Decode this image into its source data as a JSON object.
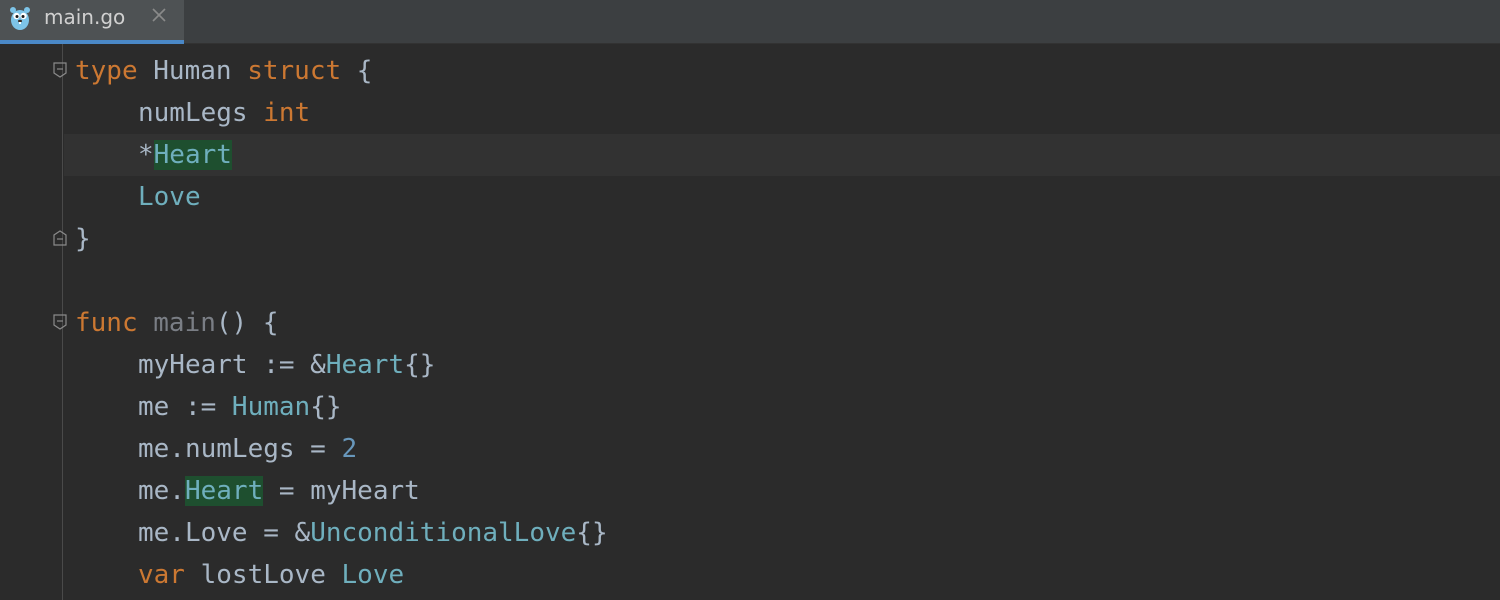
{
  "tab": {
    "filename": "main.go",
    "icon": "gopher-icon",
    "close_icon": "close-icon"
  },
  "code": {
    "l1": {
      "kw1": "type",
      "name": " Human ",
      "kw2": "struct",
      "rest": " {"
    },
    "l2": {
      "field": "numLegs ",
      "type": "int"
    },
    "l3": {
      "star": "*",
      "type": "Heart"
    },
    "l4": {
      "type": "Love"
    },
    "l5": {
      "brace": "}"
    },
    "l7": {
      "kw": "func",
      "fname": " main",
      "rest": "() {"
    },
    "l8": {
      "lhs": "myHeart := &",
      "type": "Heart",
      "rest": "{}"
    },
    "l9": {
      "lhs": "me := ",
      "type": "Human",
      "rest": "{}"
    },
    "l10": {
      "lhs": "me.numLegs = ",
      "num": "2"
    },
    "l11": {
      "lhs": "me.",
      "field": "Heart",
      "rest": " = myHeart"
    },
    "l12": {
      "lhs": "me.Love = &",
      "type": "UnconditionalLove",
      "rest": "{}"
    },
    "l13": {
      "kw": "var",
      "name": " lostLove ",
      "type": "Love"
    }
  },
  "colors": {
    "keyword": "#cc7832",
    "type": "#6fafbd",
    "number": "#6897bb",
    "text": "#a9b7c6",
    "highlight": "#1e4f2f",
    "tab_accent": "#4a88c7"
  }
}
